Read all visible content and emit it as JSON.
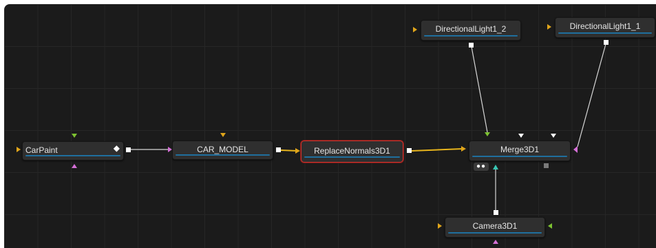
{
  "nodes": {
    "carpaint": "CarPaint",
    "car_model": "CAR_MODEL",
    "replace_normals": "ReplaceNormals3D1",
    "merge3d": "Merge3D1",
    "camera3d": "Camera3D1",
    "dir_light_2": "DirectionalLight1_2",
    "dir_light_1": "DirectionalLight1_1"
  },
  "icons": {
    "carpaint_diamond": "diamond-icon",
    "merge_dots": "dots-icon",
    "port": "square-port-icon"
  },
  "colors": {
    "background": "#1b1b1b",
    "node_fill": "#2f2f2f",
    "selected_border": "#d0332d",
    "node_bar": "#1f6f9e",
    "input_orange": "#e0a51a",
    "input_green": "#7dc231",
    "input_pink": "#d46fd6",
    "input_teal": "#38c6b4",
    "wire_yellow": "#e8b51c",
    "wire_white": "#d8d8d8"
  }
}
